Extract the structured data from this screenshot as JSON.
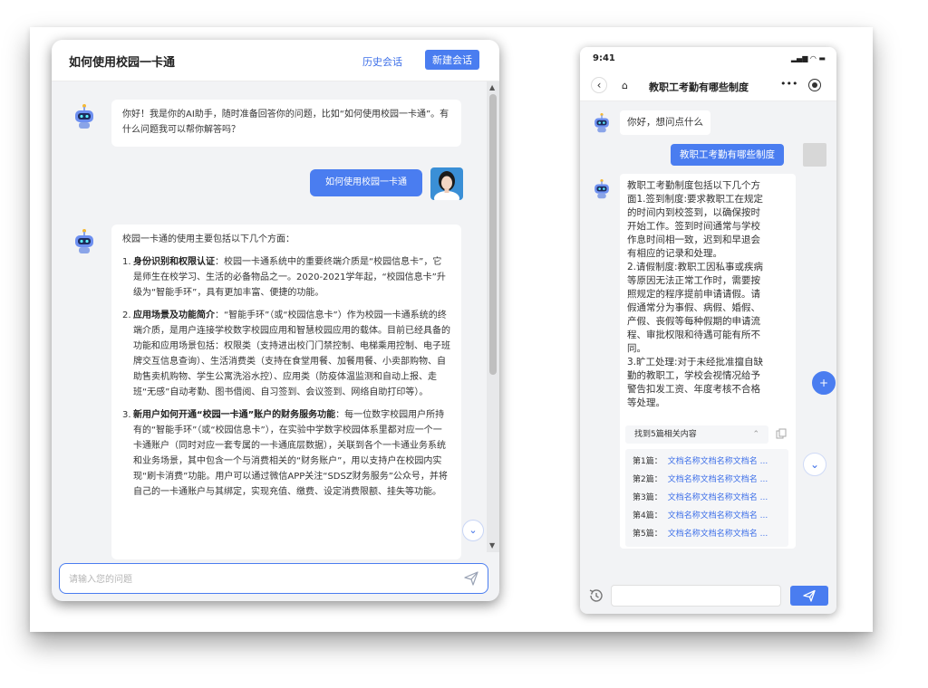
{
  "desktop": {
    "title": "如何使用校园一卡通",
    "history_label": "历史会话",
    "new_chat_label": "新建会话",
    "greeting": "你好！我是你的AI助手，随时准备回答你的问题，比如“如何使用校园一卡通”。有什么问题我可以帮你解答吗？",
    "user_question": "如何使用校园一卡通",
    "answer_intro": "校园一卡通的使用主要包括以下几个方面：",
    "answer_items": [
      {
        "num": "1.",
        "head": "身份识别和权限认证",
        "body": "：校园一卡通系统中的重要终端介质是“校园信息卡”，它是师生在校学习、生活的必备物品之一。2020-2021学年起，“校园信息卡”升级为“智能手环”，具有更加丰富、便捷的功能。"
      },
      {
        "num": "2.",
        "head": "应用场景及功能简介",
        "body": "：“智能手环”（或“校园信息卡”）作为校园一卡通系统的终端介质，是用户连接学校数字校园应用和智慧校园应用的载体。目前已经具备的功能和应用场景包括：权限类（支持进出校门门禁控制、电梯乘用控制、电子班牌交互信息查询）、生活消费类（支持在食堂用餐、加餐用餐、小卖部购物、自助售卖机购物、学生公寓洗浴水控）、应用类（防疫体温监测和自动上报、走班“无感”自动考勤、图书借阅、自习签到、会议签到、网络自助打印等）。"
      },
      {
        "num": "3.",
        "head": "新用户如何开通“校园一卡通”账户的财务服务功能",
        "body": "：每一位数字校园用户所持有的“智能手环”（或“校园信息卡”），在实验中学数字校园体系里都对应一个一卡通账户（同时对应一套专属的一卡通底层数据），关联到各个一卡通业务系统和业务场景，其中包含一个与消费相关的“财务账户”，用以支持户在校园内实现“刷卡消费”功能。用户可以通过微信APP关注“SDSZ财务服务”公众号，并将自己的一卡通账户与其绑定，实现充值、缴费、设定消费限额、挂失等功能。"
      }
    ],
    "input_placeholder": "请输入您的问题"
  },
  "mobile": {
    "time": "9:41",
    "nav_title": "教职工考勤有哪些制度",
    "bot_greeting": "你好，想问点什么",
    "user_question": "教职工考勤有哪些制度",
    "answer_lines": [
      "教职工考勤制度包括以下几个方",
      "面1.签到制度:要求教职工在规定",
      "的时间内到校签到，以确保按时",
      "开始工作。签到时间通常与学校",
      "作息时间相一致，迟到和早退会",
      "有相应的记录和处理。",
      "2.请假制度:教职工因私事或疾病",
      "等原因无法正常工作时，需要按",
      "照规定的程序提前申请请假。请",
      "假通常分为事假、病假、婚假、",
      "产假、丧假等每种假期的申请流",
      "程、审批权限和待遇可能有所不",
      "同。",
      "3.旷工处理:对于未经批准擅自缺",
      "勤的教职工，学校会视情况给予",
      "警告扣发工资、年度考核不合格",
      "等处理。"
    ],
    "related_header": "找到5篇相关内容",
    "docs": [
      {
        "index": "第1篇：",
        "name": "文档名称文档名称文档名 ..."
      },
      {
        "index": "第2篇：",
        "name": "文档名称文档名称文档名 ..."
      },
      {
        "index": "第3篇：",
        "name": "文档名称文档名称文档名 ..."
      },
      {
        "index": "第4篇：",
        "name": "文档名称文档名称文档名 ..."
      },
      {
        "index": "第5篇：",
        "name": "文档名称文档名称文档名 ..."
      }
    ]
  },
  "colors": {
    "accent": "#4a7df0",
    "panel_bg": "#f2f3f5"
  }
}
